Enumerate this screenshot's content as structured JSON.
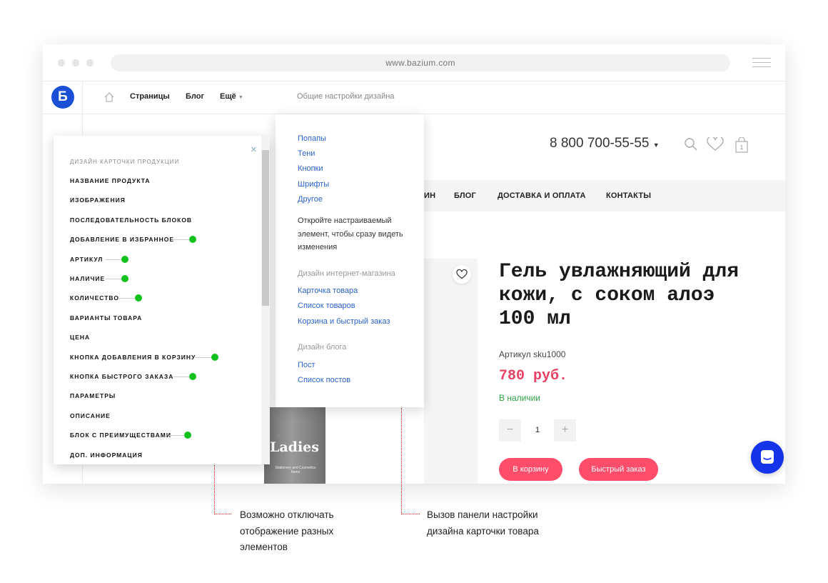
{
  "browser": {
    "url": "www.bazium.com"
  },
  "topbar": {
    "logo": "Б",
    "nav": [
      "Страницы",
      "Блог",
      "Ещё"
    ],
    "design_settings": "Общие настройки дизайна"
  },
  "dropdown": {
    "group1": [
      "Попапы",
      "Тени",
      "Кнопки",
      "Шрифты",
      "Другое"
    ],
    "hint": "Откройте настраиваемый элемент, чтобы сразу видеть изменения",
    "shop_heading": "Дизайн интернет-магазина",
    "shop_links": [
      "Карточка товара",
      "Список товаров",
      "Корзина и быстрый заказ"
    ],
    "blog_heading": "Дизайн блога",
    "blog_links": [
      "Пост",
      "Список постов"
    ]
  },
  "header": {
    "phone": "8 800 700-55-55"
  },
  "main_nav": [
    "ИН",
    "БЛОГ",
    "ДОСТАВКА И ОПЛАТА",
    "КОНТАКТЫ"
  ],
  "product": {
    "title": "Гель увлажняющий для кожи, с соком алоэ 100 мл",
    "sku": "Артикул sku1000",
    "price": "780 руб.",
    "stock": "В наличии",
    "quantity": "1",
    "add_to_cart": "В корзину",
    "quick_order": "Быстрый заказ",
    "image_brand": "Ladies",
    "image_caption": "Stationery and Cosmetics Items"
  },
  "panel": {
    "title": "ДИЗАЙН КАРТОЧКИ ПРОДУКЦИИ",
    "items": [
      {
        "label": "НАЗВАНИЕ ПРОДУКТА",
        "toggle": false
      },
      {
        "label": "ИЗОБРАЖЕНИЯ",
        "toggle": false
      },
      {
        "label": "ПОСЛЕДОВАТЕЛЬНОСТЬ БЛОКОВ",
        "toggle": false
      },
      {
        "label": "ДОБАВЛЕНИЕ В ИЗБРАННОЕ",
        "toggle": true
      },
      {
        "label": "АРТИКУЛ",
        "toggle": true
      },
      {
        "label": "НАЛИЧИЕ",
        "toggle": true
      },
      {
        "label": "КОЛИЧЕСТВО",
        "toggle": true
      },
      {
        "label": "ВАРИАНТЫ ТОВАРА",
        "toggle": false
      },
      {
        "label": "ЦЕНА",
        "toggle": false
      },
      {
        "label": "КНОПКА ДОБАВЛЕНИЯ В КОРЗИНУ",
        "toggle": true
      },
      {
        "label": "КНОПКА БЫСТРОГО ЗАКАЗА",
        "toggle": true
      },
      {
        "label": "ПАРАМЕТРЫ",
        "toggle": false
      },
      {
        "label": "ОПИСАНИЕ",
        "toggle": false
      },
      {
        "label": "БЛОК С ПРЕИМУЩЕСТВАМИ",
        "toggle": true
      },
      {
        "label": "ДОП. ИНФОРМАЦИЯ",
        "toggle": false
      }
    ]
  },
  "annotations": {
    "left": [
      "Возможно отключать",
      "отображение разных",
      "элементов"
    ],
    "right": [
      "Вызов панели настройки",
      "дизайна карточки товара"
    ]
  },
  "colors": {
    "accent": "#ff4d6a",
    "link": "#2a62c9",
    "toggle_on": "#12c11c",
    "annotation_line": "#d60f0f",
    "logo": "#1a4fd6"
  }
}
